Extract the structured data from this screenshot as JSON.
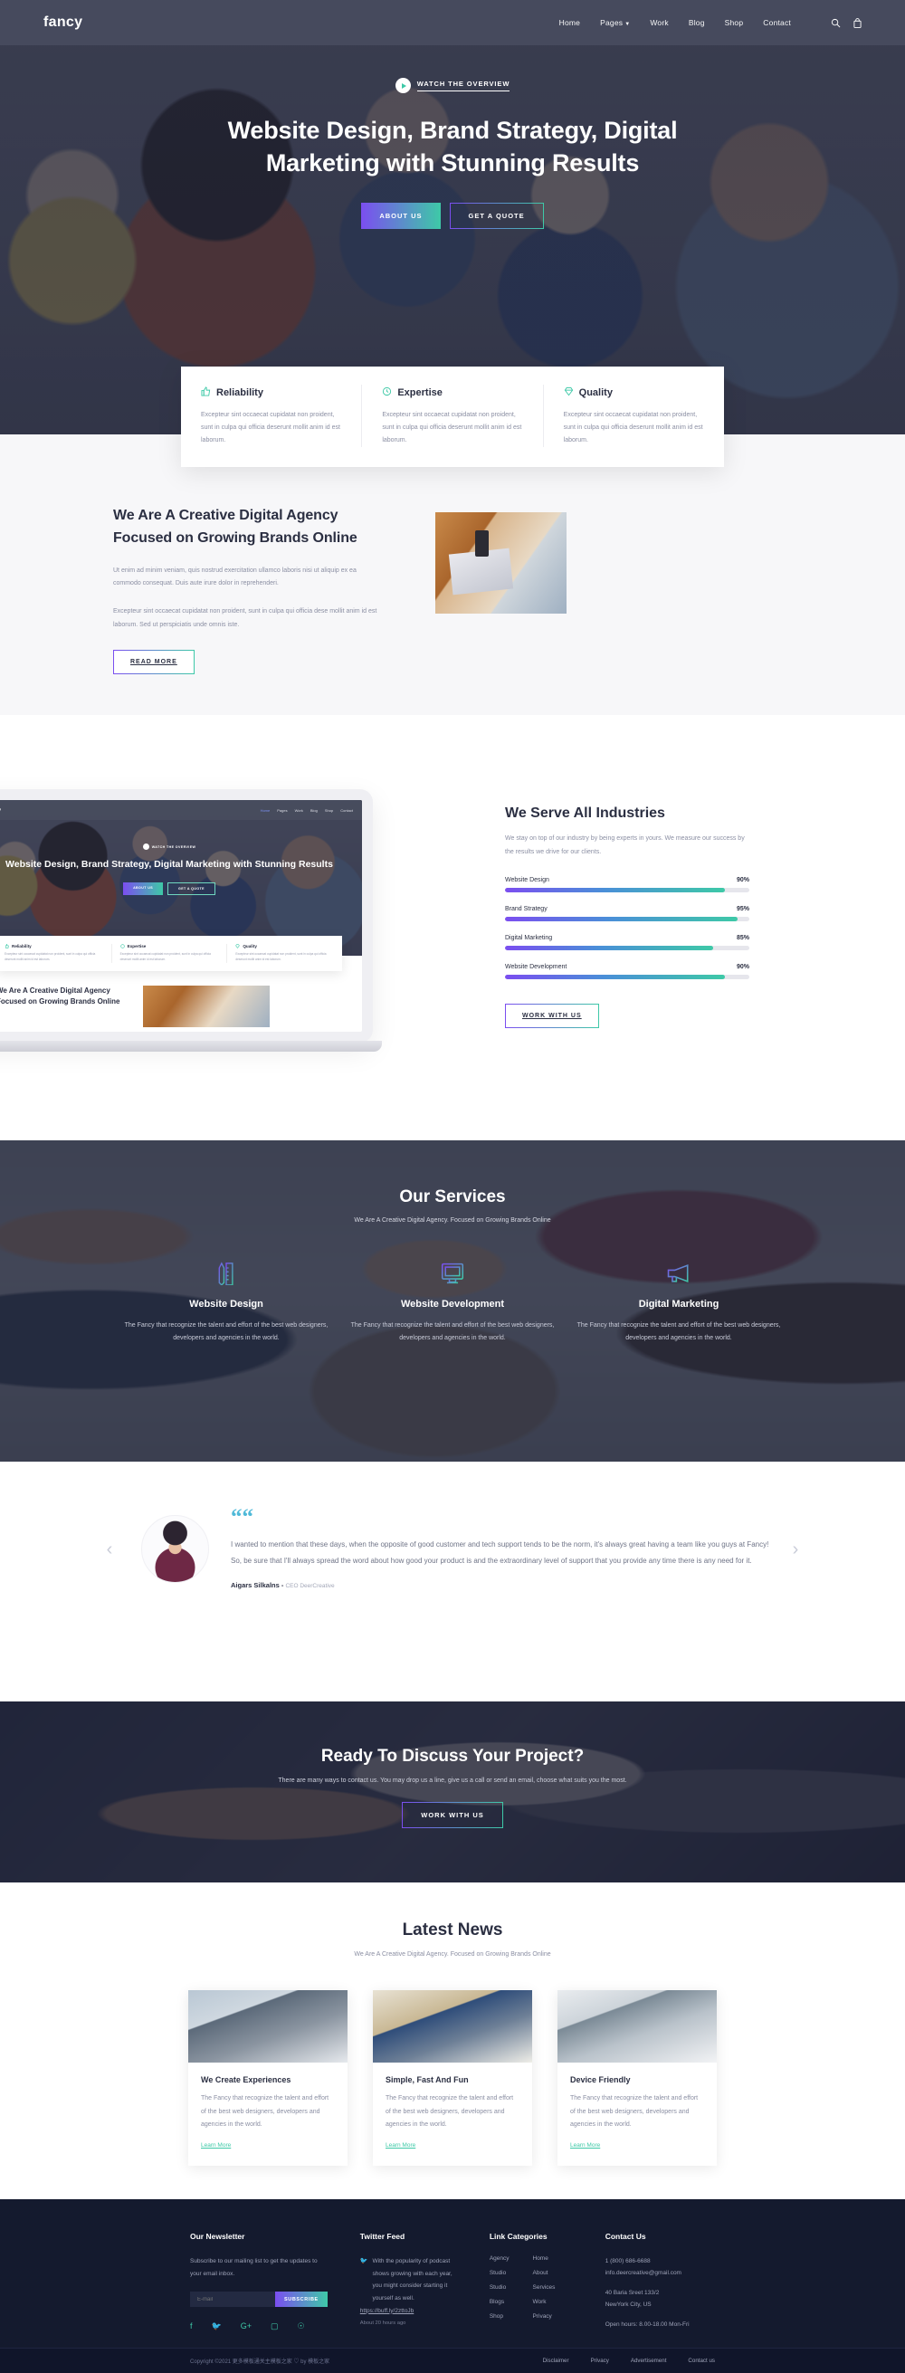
{
  "header": {
    "brand": "fancy",
    "nav": [
      {
        "label": "Home",
        "active": true,
        "caret": false
      },
      {
        "label": "Pages",
        "active": false,
        "caret": true
      },
      {
        "label": "Work",
        "active": false,
        "caret": false
      },
      {
        "label": "Blog",
        "active": false,
        "caret": false
      },
      {
        "label": "Shop",
        "active": false,
        "caret": false
      },
      {
        "label": "Contact",
        "active": false,
        "caret": false
      }
    ],
    "icons": [
      "search-icon",
      "cart-icon"
    ]
  },
  "hero": {
    "watch_label": "WATCH THE OVERVIEW",
    "title": "Website Design, Brand Strategy, Digital Marketing with Stunning Results",
    "btn_primary": "ABOUT US",
    "btn_secondary": "GET A QUOTE"
  },
  "features": [
    {
      "icon": "thumbs-up-icon",
      "title": "Reliability",
      "text": "Excepteur sint occaecat cupidatat non proident, sunt in culpa qui officia deserunt mollit anim id est laborum."
    },
    {
      "icon": "clock-icon",
      "title": "Expertise",
      "text": "Excepteur sint occaecat cupidatat non proident, sunt in culpa qui officia deserunt mollit anim id est laborum."
    },
    {
      "icon": "diamond-icon",
      "title": "Quality",
      "text": "Excepteur sint occaecat cupidatat non proident, sunt in culpa qui officia deserunt mollit anim id est laborum."
    }
  ],
  "about": {
    "title": "We Are A Creative Digital Agency Focused on Growing Brands Online",
    "p1": "Ut enim ad minim veniam, quis nostrud exercitation ullamco laboris nisi ut aliquip ex ea commodo consequat. Duis aute irure dolor in reprehenderi.",
    "p2": "Excepteur sint occaecat cupidatat non proident, sunt in culpa qui officia dese mollit anim id est laborum. Sed ut perspiciatis unde omnis iste.",
    "button": "READ MORE"
  },
  "industries": {
    "title": "We Serve All Industries",
    "subtitle": "We stay on top of our industry by being experts in yours. We measure our success by the results we drive for our clients.",
    "button": "WORK WITH US",
    "chart_data": {
      "type": "bar",
      "title": "We Serve All Industries",
      "categories": [
        "Website Design",
        "Brand Strategy",
        "Digital Marketing",
        "Website Development"
      ],
      "values": [
        90,
        95,
        85,
        90
      ],
      "labels": [
        "90%",
        "95%",
        "85%",
        "90%"
      ],
      "xlabel": "",
      "ylabel": "",
      "ylim": [
        0,
        100
      ],
      "orientation": "horizontal",
      "grid": false,
      "legend": false
    }
  },
  "services": {
    "title": "Our Services",
    "subtitle": "We Are A Creative Digital Agency. Focused on Growing Brands Online",
    "items": [
      {
        "icon": "pencil-ruler-icon",
        "name": "Website Design",
        "text": "The Fancy that recognize the talent and effort of the best web designers, developers and agencies in the world."
      },
      {
        "icon": "monitor-icon",
        "name": "Website Development",
        "text": "The Fancy that recognize the talent and effort of the best web designers, developers and agencies in the world."
      },
      {
        "icon": "megaphone-icon",
        "name": "Digital Marketing",
        "text": "The Fancy that recognize the talent and effort of the best web designers, developers and agencies in the world."
      }
    ]
  },
  "testimonial": {
    "quote": "I wanted to mention that these days, when the opposite of good customer and tech support tends to be the norm, it's always great having a team like you guys at Fancy! So, be sure that I'll always spread the word about how good your product is and the extraordinary level of support that you provide any time there is any need for it.",
    "author": "Aigars Silkalns - ",
    "role": "CEO DeerCreative",
    "prev": "‹",
    "next": "›"
  },
  "cta": {
    "title": "Ready To Discuss Your Project?",
    "subtitle": "There are many ways to contact us. You may drop us a line, give us a call or send an email, choose what suits you the most.",
    "button": "WORK WITH US"
  },
  "news": {
    "title": "Latest News",
    "subtitle": "We Are A Creative Digital Agency. Focused on Growing Brands Online",
    "cards": [
      {
        "title": "We Create Experiences",
        "text": "The Fancy that recognize the talent and effort of the best web designers, developers and agencies in the world.",
        "link": "Learn More"
      },
      {
        "title": "Simple, Fast And Fun",
        "text": "The Fancy that recognize the talent and effort of the best web designers, developers and agencies in the world.",
        "link": "Learn More"
      },
      {
        "title": "Device Friendly",
        "text": "The Fancy that recognize the talent and effort of the best web designers, developers and agencies in the world.",
        "link": "Learn More"
      }
    ]
  },
  "footer": {
    "newsletter": {
      "heading": "Our Newsletter",
      "text": "Subscribe to our mailing list to get the updates to your email inbox.",
      "placeholder": "E-mail",
      "value": "",
      "button": "SUBSCRIBE",
      "socials": [
        "facebook-icon",
        "twitter-icon",
        "google-plus-icon",
        "instagram-icon",
        "pinterest-icon"
      ]
    },
    "twitter": {
      "heading": "Twitter Feed",
      "text": "With the popularity of podcast shows growing with each year, you might consider starting it yourself as well.",
      "link": "https://buff.ly/2zttoJb",
      "ago": "About 20 hours ago"
    },
    "links": {
      "heading": "Link Categories",
      "col1": [
        "Agency",
        "Studio",
        "Studio",
        "Blogs",
        "Shop"
      ],
      "col2": [
        "Home",
        "About",
        "Services",
        "Work",
        "Privacy"
      ]
    },
    "contact": {
      "heading": "Contact Us",
      "phone": "1 (800) 686-6688",
      "email": "info.deercreative@gmail.com",
      "address1": "40 Baria Sreet 133/2",
      "address2": "NewYork City, US",
      "hours": "Open hours: 8.00-18.00 Mon-Fri"
    },
    "bottom": {
      "copyright": "Copyright ©2021 更多模板通关主模板之家 ♡ by 模板之家",
      "links": [
        "Disclaimer",
        "Privacy",
        "Advertisement",
        "Contact us"
      ]
    }
  },
  "laptop_preview": {
    "brand": "fancy",
    "nav": [
      "Home",
      "Pages",
      "Work",
      "Blog",
      "Shop",
      "Contact"
    ],
    "watch_label": "WATCH THE OVERVIEW",
    "title": "Website Design, Brand Strategy, Digital Marketing with Stunning Results",
    "btn_primary": "ABOUT US",
    "btn_secondary": "GET A QUOTE",
    "cards": [
      {
        "title": "Reliability",
        "text": "Excepteur sint occaecat cupidatat non proident, sunt in culpa qui officia deserunt mollit anim id est laborum."
      },
      {
        "title": "Expertise",
        "text": "Excepteur sint occaecat cupidatat non proident, sunt in culpa qui officia deserunt mollit anim id est laborum."
      },
      {
        "title": "Quality",
        "text": "Excepteur sint occaecat cupidatat non proident, sunt in culpa qui officia deserunt mollit anim id est laborum."
      }
    ],
    "about_title": "We Are A Creative Digital Agency Focused on Growing Brands Online"
  },
  "colors": {
    "accent_purple": "#7b4ef0",
    "accent_teal": "#3ec9a7",
    "dark": "#141a2e",
    "text": "#2b2f42",
    "muted": "#8b8fa3"
  }
}
